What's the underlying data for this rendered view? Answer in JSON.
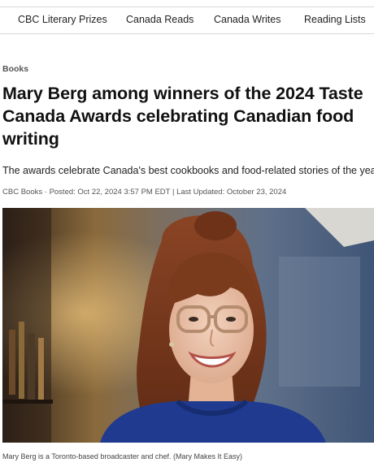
{
  "nav": {
    "items": [
      {
        "label": "CBC Literary Prizes"
      },
      {
        "label": "Canada Reads"
      },
      {
        "label": "Canada Writes"
      },
      {
        "label": "Reading Lists"
      }
    ]
  },
  "article": {
    "section": "Books",
    "headline": {
      "line1": "Mary Berg among winners of the 2024 Taste",
      "line2": "Canada Awards celebrating Canadian food",
      "line3": "writing"
    },
    "deck": "The awards celebrate Canada's best cookbooks and food-related stories of the year",
    "byline": {
      "author": "CBC Books",
      "sep1": " · ",
      "posted": "Posted: Oct 22, 2024 3:57 PM EDT",
      "sep2": " | ",
      "updated": "Last Updated: October 23, 2024"
    },
    "photo": {
      "caption": "Mary Berg is a Toronto-based broadcaster and chef. (Mary Makes It Easy)"
    }
  },
  "colors": {
    "text": "#111111",
    "muted": "#555555",
    "rule": "#d8d8d8",
    "sweater": "#1f3a8f",
    "hair": "#7a3a1c"
  }
}
